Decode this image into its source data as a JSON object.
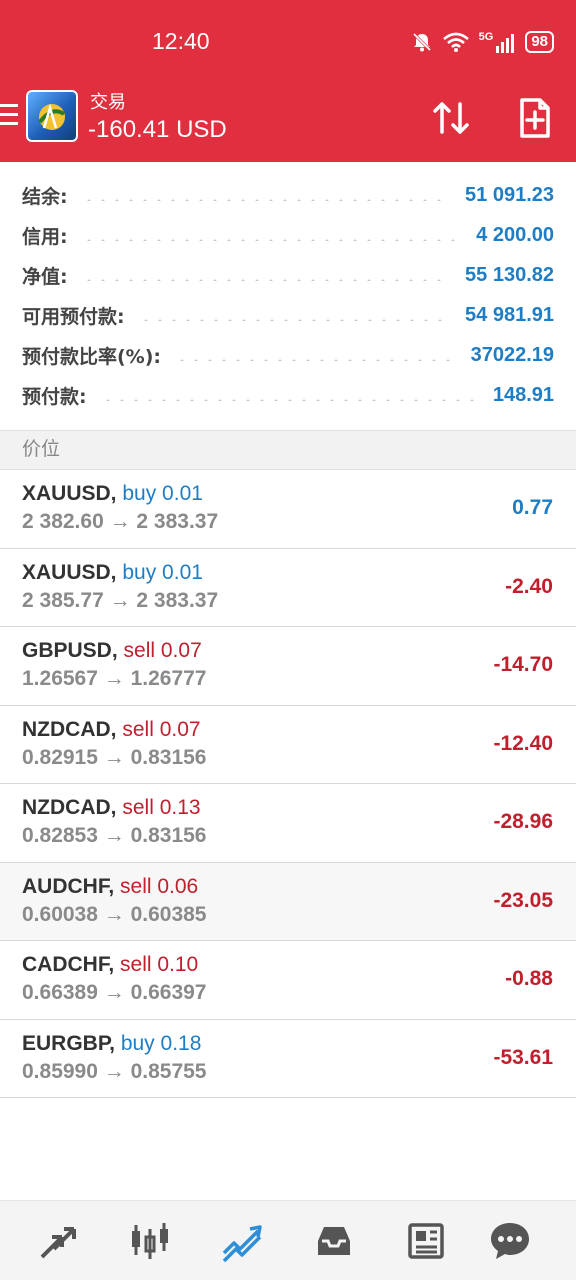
{
  "status_bar": {
    "time": "12:40",
    "network": "5G",
    "battery": "98"
  },
  "header": {
    "title": "交易",
    "value": "-160.41 USD",
    "icons": [
      "menu-icon",
      "app-logo",
      "sort-icon",
      "new-order-icon"
    ]
  },
  "summary": {
    "rows": [
      {
        "label": "结余:",
        "value": "51 091.23"
      },
      {
        "label": "信用:",
        "value": "4 200.00"
      },
      {
        "label": "净值:",
        "value": "55 130.82"
      },
      {
        "label": "可用预付款:",
        "value": "54 981.91"
      },
      {
        "label": "预付款比率(%):",
        "value": "37022.19"
      },
      {
        "label": "预付款:",
        "value": "148.91"
      }
    ]
  },
  "section": {
    "title": "价位"
  },
  "positions": [
    {
      "symbol": "XAUUSD,",
      "side": "buy",
      "side_text": "buy 0.01",
      "prices": "2 382.60 → 2 383.37",
      "profit": "0.77"
    },
    {
      "symbol": "XAUUSD,",
      "side": "buy",
      "side_text": "buy 0.01",
      "prices": "2 385.77 → 2 383.37",
      "profit": "-2.40"
    },
    {
      "symbol": "GBPUSD,",
      "side": "sell",
      "side_text": "sell 0.07",
      "prices": "1.26567 → 1.26777",
      "profit": "-14.70"
    },
    {
      "symbol": "NZDCAD,",
      "side": "sell",
      "side_text": "sell 0.07",
      "prices": "0.82915 → 0.83156",
      "profit": "-12.40"
    },
    {
      "symbol": "NZDCAD,",
      "side": "sell",
      "side_text": "sell 0.13",
      "prices": "0.82853 → 0.83156",
      "profit": "-28.96"
    },
    {
      "symbol": "AUDCHF,",
      "side": "sell",
      "side_text": "sell 0.06",
      "prices": "0.60038 → 0.60385",
      "profit": "-23.05"
    },
    {
      "symbol": "CADCHF,",
      "side": "sell",
      "side_text": "sell 0.10",
      "prices": "0.66389 → 0.66397",
      "profit": "-0.88"
    },
    {
      "symbol": "EURGBP,",
      "side": "buy",
      "side_text": "buy 0.18",
      "prices": "0.85990 → 0.85755",
      "profit": "-53.61"
    }
  ],
  "bottom_nav": {
    "items": [
      "quotes-icon",
      "chart-icon",
      "trade-icon",
      "history-icon",
      "news-icon",
      "messages-icon"
    ],
    "active": "trade-icon"
  },
  "colors": {
    "header_bg": "#e03040",
    "positive": "#1e7dc4",
    "negative": "#c0202e",
    "active_nav": "#2e8fd8",
    "inactive_nav": "#555555"
  }
}
